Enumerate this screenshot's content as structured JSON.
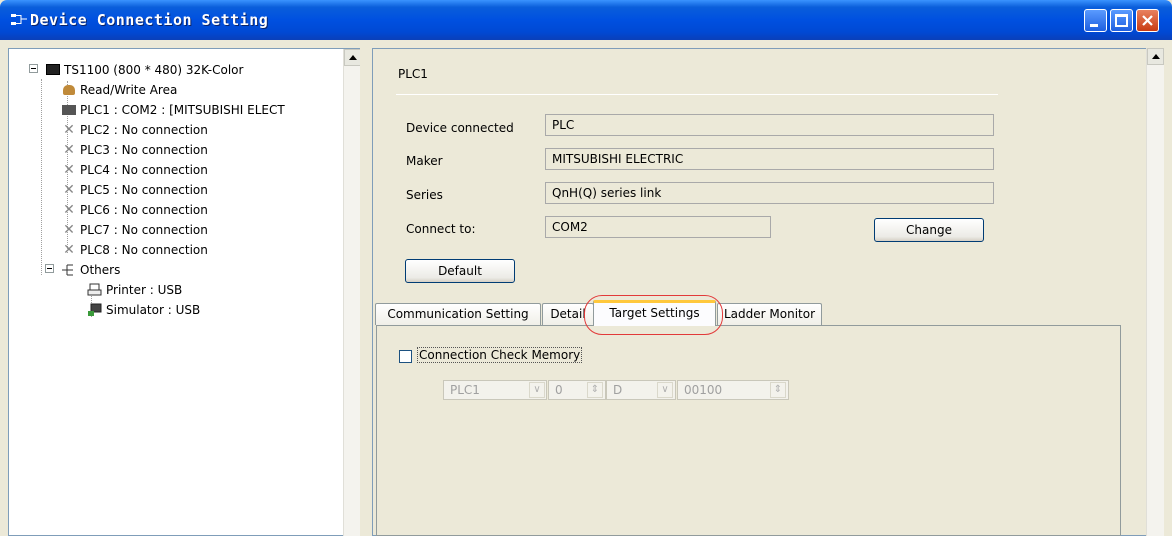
{
  "window": {
    "title": "Device Connection Setting"
  },
  "tree": {
    "root": "TS1100 (800 * 480) 32K-Color",
    "items": [
      "Read/Write Area",
      "PLC1 : COM2 : [MITSUBISHI ELECT",
      "PLC2 : No connection",
      "PLC3 : No connection",
      "PLC4 : No connection",
      "PLC5 : No connection",
      "PLC6 : No connection",
      "PLC7 : No connection",
      "PLC8 : No connection"
    ],
    "others": "Others",
    "printer": "Printer : USB",
    "simulator": "Simulator : USB"
  },
  "device": {
    "heading": "PLC1",
    "device_connected_label": "Device connected",
    "device_connected_value": "PLC",
    "maker_label": "Maker",
    "maker_value": "MITSUBISHI ELECTRIC",
    "series_label": "Series",
    "series_value": "QnH(Q) series link",
    "connect_to_label": "Connect to:",
    "connect_to_value": "COM2",
    "change_button": "Change",
    "default_button": "Default"
  },
  "tabs": [
    "Communication Setting",
    "Detail",
    "Target Settings",
    "Ladder Monitor"
  ],
  "target": {
    "checkbox_label": "Connection Check Memory",
    "plc_select": "PLC1",
    "number_value": "0",
    "device_select": "D",
    "address_value": "00100"
  },
  "colors": {
    "titlebar": "#0050E0",
    "highlight": "#E23A3A",
    "active_tab_accent": "#FFC83C"
  }
}
